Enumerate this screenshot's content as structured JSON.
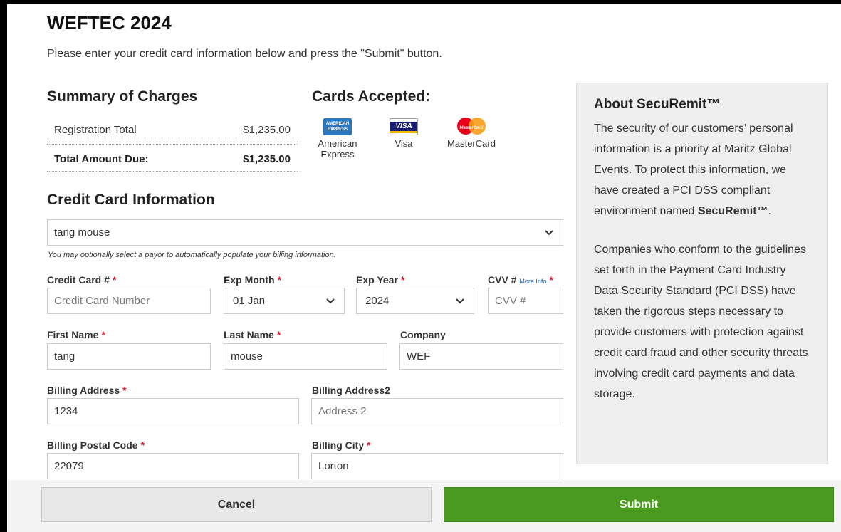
{
  "page": {
    "title": "WEFTEC 2024",
    "intro": "Please enter your credit card information below and press the \"Submit\" button."
  },
  "summary": {
    "heading": "Summary of Charges",
    "rows": [
      {
        "label": "Registration Total",
        "value": "$1,235.00"
      },
      {
        "label": "Total Amount Due:",
        "value": "$1,235.00"
      }
    ]
  },
  "cards": {
    "heading": "Cards Accepted:",
    "items": [
      {
        "name_line1": "American",
        "name_line2": "Express",
        "icon": "amex-logo",
        "logo_text": "AMERICAN EXPRESS"
      },
      {
        "name_line1": "Visa",
        "icon": "visa-logo",
        "logo_text": "VISA"
      },
      {
        "name_line1": "MasterCard",
        "icon": "mastercard-logo",
        "logo_text": "MasterCard"
      }
    ]
  },
  "form": {
    "heading": "Credit Card Information",
    "payor_select": {
      "value": "tang mouse"
    },
    "payor_hint": "You may optionally select a payor to automatically populate your billing information.",
    "card_number": {
      "label": "Credit Card #",
      "placeholder": "Credit Card Number",
      "value": ""
    },
    "exp_month": {
      "label": "Exp Month",
      "value": "01 Jan"
    },
    "exp_year": {
      "label": "Exp Year",
      "value": "2024"
    },
    "cvv": {
      "label": "CVV #",
      "more_info": "More Info",
      "placeholder": "CVV #",
      "value": ""
    },
    "first_name": {
      "label": "First Name",
      "value": "tang"
    },
    "last_name": {
      "label": "Last Name",
      "value": "mouse"
    },
    "company": {
      "label": "Company",
      "value": "WEF"
    },
    "billing_address": {
      "label": "Billing Address",
      "value": "1234"
    },
    "billing_address2": {
      "label": "Billing Address2",
      "placeholder": "Address 2",
      "value": ""
    },
    "postal_code": {
      "label": "Billing Postal Code",
      "value": "22079"
    },
    "city": {
      "label": "Billing City",
      "value": "Lorton"
    },
    "required_marker": "*"
  },
  "about": {
    "heading": "About SecuRemit™",
    "para1_pre": "The security of our customers’ personal information is a priority at Maritz Global Events. To protect this information, we have created a PCI DSS compliant environment named ",
    "para1_bold": "SecuRemit™",
    "para1_post": ".",
    "para2": "Companies who conform to the guidelines set forth in the Payment Card Industry Data Security Standard (PCI DSS) have taken the rigorous steps necessary to provide customers with protection against credit card fraud and other security threats involving credit card payments and data storage."
  },
  "footer": {
    "cancel_label": "Cancel",
    "submit_label": "Submit"
  },
  "colors": {
    "submit_green": "#4a9a20",
    "required_red": "#d3141f",
    "link_blue": "#1a5fb4",
    "about_bg": "#eeeeee"
  }
}
